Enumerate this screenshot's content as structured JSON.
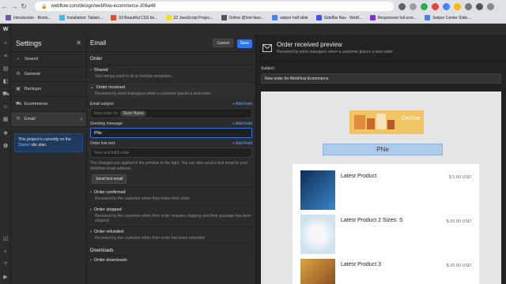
{
  "browser": {
    "url": "webflow.com/design/webflow-ecommerce-306a48",
    "bookmarks": [
      {
        "label": "Introduction · Boots...",
        "color": "#7952b3"
      },
      {
        "label": "Installation: Tailwin...",
        "color": "#38bdf8"
      },
      {
        "label": "93 Beautiful CSS bo...",
        "color": "#e44d26"
      },
      {
        "label": "22 JavaScript Projec...",
        "color": "#f7df1e"
      },
      {
        "label": "Online @font-face...",
        "color": "#555555"
      },
      {
        "label": "swiper half slide",
        "color": "#4285f4"
      },
      {
        "label": "SideBar Nav · Webf...",
        "color": "#4353ff"
      },
      {
        "label": "Responsive full-scre...",
        "color": "#8a2be2"
      },
      {
        "label": "Swiper Center Slide...",
        "color": "#4285f4"
      }
    ]
  },
  "settings": {
    "title": "Settings",
    "items": [
      {
        "label": "Search",
        "icon": "search-icon",
        "glyph": "⌕"
      },
      {
        "label": "General",
        "icon": "gear-icon",
        "glyph": "⚙"
      },
      {
        "label": "Backups",
        "icon": "backup-icon",
        "glyph": "▣"
      },
      {
        "label": "Ecommerce",
        "icon": "cart-icon",
        "glyph": "⛟"
      },
      {
        "label": "Email",
        "icon": "mail-icon",
        "glyph": "✉"
      }
    ],
    "plan_note_prefix": "This project is currently on the",
    "plan_link": "Starter",
    "plan_note_suffix": "site plan."
  },
  "email": {
    "title": "Email",
    "cancel": "Cancel",
    "save": "Save",
    "section": "Order",
    "shared_title": "Shared",
    "shared_sub": "Text strings used in all or multiple templates.",
    "received_title": "Order received",
    "received_sub": "Received by store managers when a customer places a new order",
    "subject_label": "Email subject",
    "add_field": "+ Add Field",
    "subject_prefix": "New order for",
    "subject_chip": "Store Name",
    "greeting_label": "Greeting message",
    "greeting_value": "PNe",
    "link_label": "Order link text",
    "link_placeholder": "View and fulfill order",
    "helper": "The changes are applied in the preview to the right. You can also send a test email to your Webflow email address.",
    "test_btn": "Send test email",
    "confirmed_title": "Order confirmed",
    "confirmed_sub": "Received by the customer when they make their order",
    "shipped_title": "Order shipped",
    "shipped_sub": "Received by the customer when their order requires shipping and their package has been shipped",
    "refunded_title": "Order refunded",
    "refunded_sub": "Received by the customer when their order has been refunded",
    "downloads_label": "Downloads",
    "downloads_item": "Order downloads"
  },
  "preview": {
    "title": "Order received preview",
    "sub": "Received by store managers when a customer places a new order",
    "subject_label": "Subject:",
    "subject_value": "New order for WebFlow Ecommerce",
    "banner_text": "Online",
    "greeting": "PNe",
    "products": [
      {
        "name": "Latest Product",
        "price": "$ 5.00 USD",
        "img": "#1e4f8a"
      },
      {
        "name": "Latest Product 2 Sizes: S",
        "price": "$ 15.00 USD",
        "img": "#cfe3ef"
      },
      {
        "name": "Latest Product 3",
        "price": "$ 25.00 USD",
        "img": "#d9a441"
      }
    ]
  }
}
